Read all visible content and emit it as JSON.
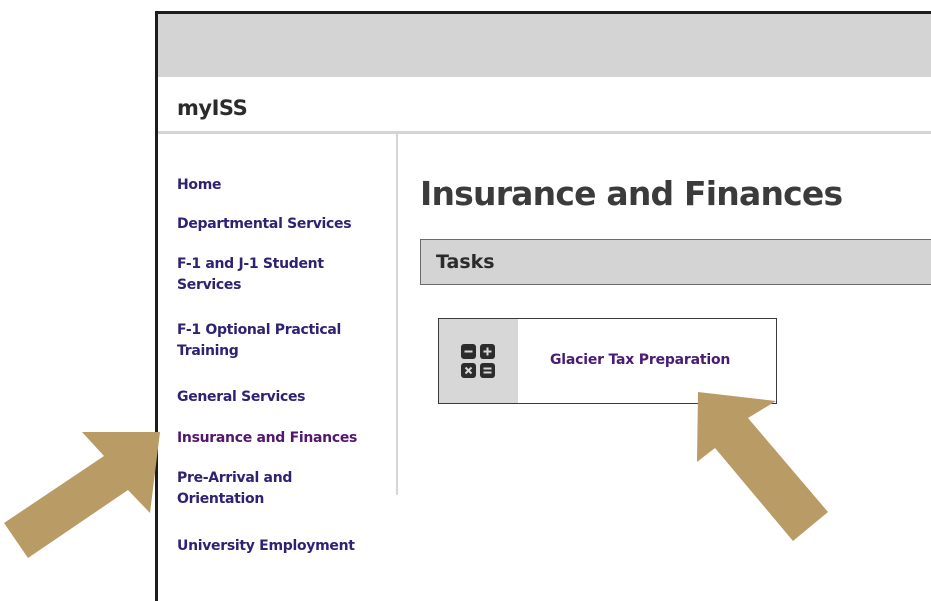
{
  "header": {
    "site_title": "myISS"
  },
  "sidebar": {
    "items": [
      {
        "label": "Home"
      },
      {
        "label": "Departmental Services"
      },
      {
        "label": "F-1 and J-1 Student Services"
      },
      {
        "label": "F-1 Optional Practical Training"
      },
      {
        "label": "General Services"
      },
      {
        "label": "Insurance and Finances",
        "active": true
      },
      {
        "label": "Pre-Arrival and Orientation"
      },
      {
        "label": "University Employment"
      }
    ]
  },
  "main": {
    "page_title": "Insurance and Finances",
    "tasks_heading": "Tasks",
    "tasks": [
      {
        "label": "Glacier Tax Preparation",
        "icon": "calculator-icon"
      }
    ]
  },
  "annotations": {
    "arrow_color": "#b99b66"
  },
  "colors": {
    "nav_link": "#2e2372",
    "nav_active": "#54176f",
    "header_gray": "#d4d4d4"
  }
}
